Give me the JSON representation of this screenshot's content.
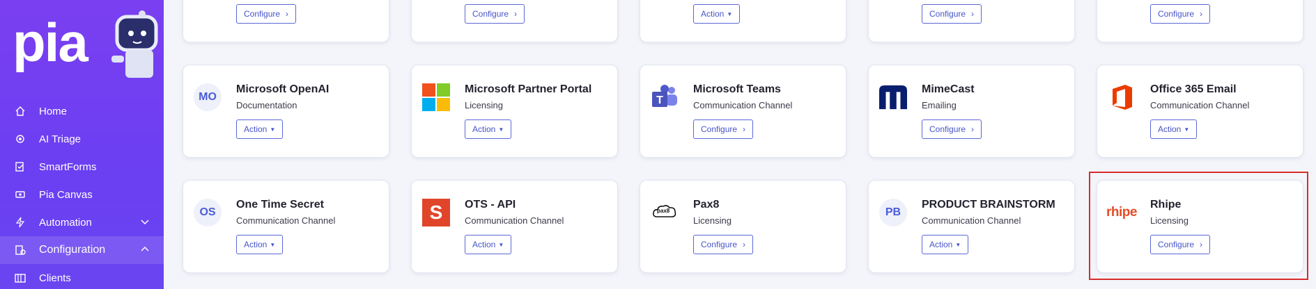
{
  "brand": {
    "logo_text": "pia"
  },
  "sidebar": {
    "items": [
      {
        "label": "Home",
        "icon": "home-icon"
      },
      {
        "label": "AI Triage",
        "icon": "ai-triage-icon"
      },
      {
        "label": "SmartForms",
        "icon": "smartforms-icon"
      },
      {
        "label": "Pia Canvas",
        "icon": "canvas-icon"
      },
      {
        "label": "Automation",
        "icon": "lightning-icon",
        "chevron": "down"
      },
      {
        "label": "Configuration",
        "icon": "configuration-icon",
        "chevron": "up",
        "active": true
      },
      {
        "label": "Clients",
        "icon": "clients-icon"
      }
    ]
  },
  "top_row_buttons": [
    "Configure",
    "Configure",
    "Action",
    "Configure",
    "Configure"
  ],
  "cards": [
    {
      "title": "Microsoft OpenAI",
      "category": "Documentation",
      "button": "Action",
      "logo": "MO"
    },
    {
      "title": "Microsoft Partner Portal",
      "category": "Licensing",
      "button": "Action",
      "logo": "microsoft-logo"
    },
    {
      "title": "Microsoft Teams",
      "category": "Communication Channel",
      "button": "Configure",
      "logo": "teams-logo"
    },
    {
      "title": "MimeCast",
      "category": "Emailing",
      "button": "Configure",
      "logo": "mimecast-logo"
    },
    {
      "title": "Office 365 Email",
      "category": "Communication Channel",
      "button": "Action",
      "logo": "office-logo"
    },
    {
      "title": "One Time Secret",
      "category": "Communication Channel",
      "button": "Action",
      "logo": "OS"
    },
    {
      "title": "OTS - API",
      "category": "Communication Channel",
      "button": "Action",
      "logo": "S"
    },
    {
      "title": "Pax8",
      "category": "Licensing",
      "button": "Configure",
      "logo": "pax8"
    },
    {
      "title": "PRODUCT BRAINSTORM",
      "category": "Communication Channel",
      "button": "Action",
      "logo": "PB"
    },
    {
      "title": "Rhipe",
      "category": "Licensing",
      "button": "Configure",
      "logo": "rhipe"
    }
  ],
  "colors": {
    "sidebar": "#6b3ff2",
    "button_border": "#5a67d8",
    "highlight": "#d92b2b",
    "background": "#f3f5fa"
  }
}
